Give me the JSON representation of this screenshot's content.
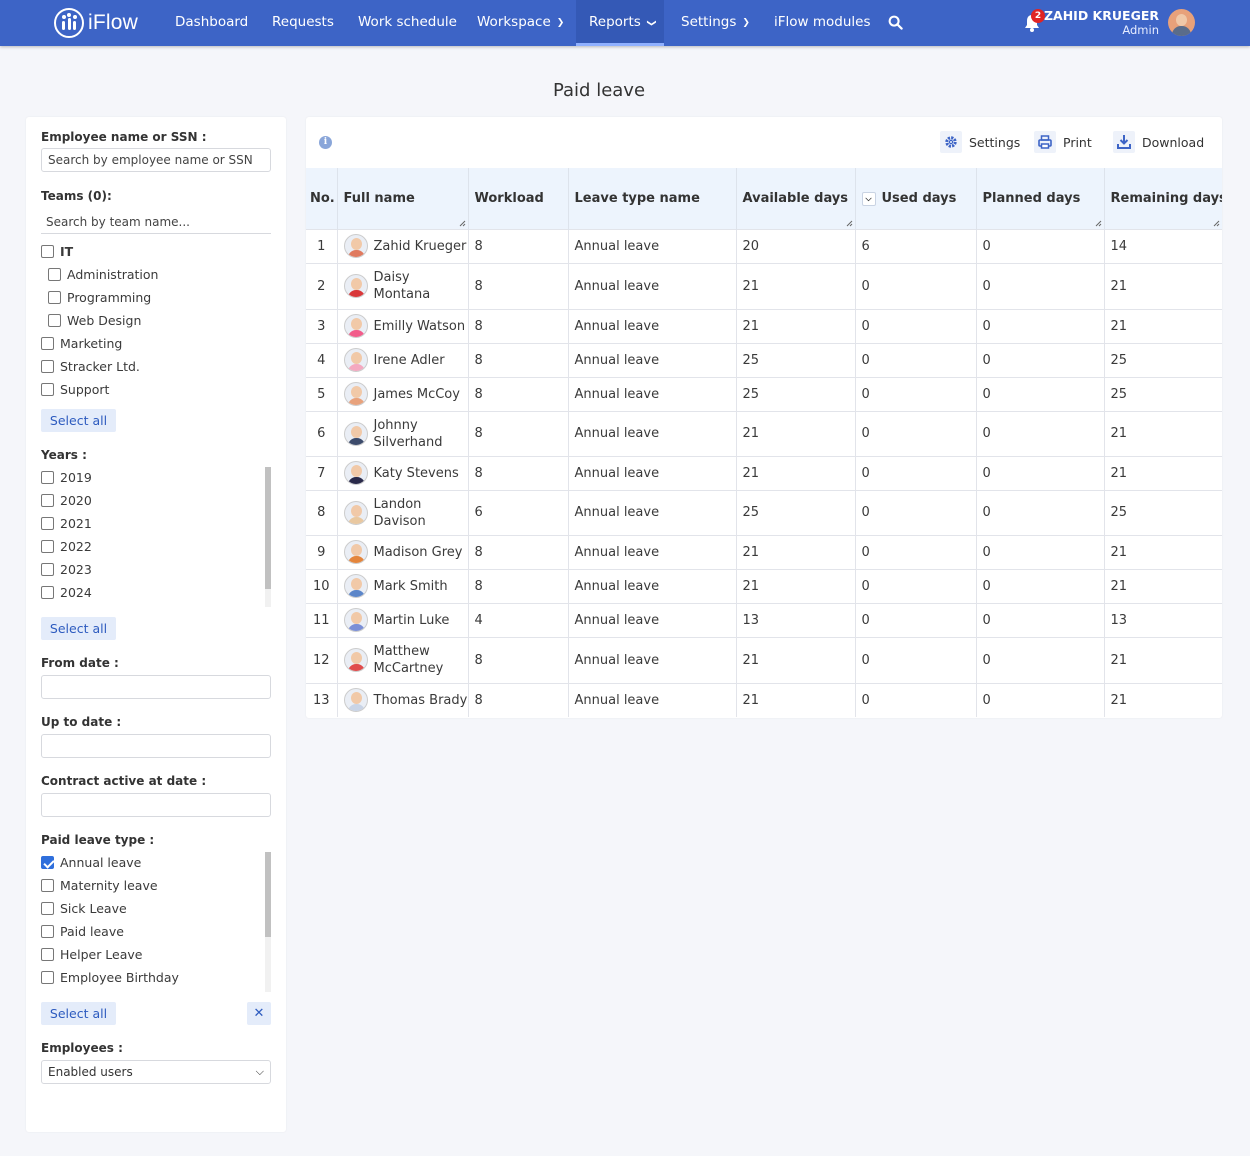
{
  "app": {
    "brand": "iFlow"
  },
  "nav": {
    "items": [
      {
        "label": "Dashboard"
      },
      {
        "label": "Requests"
      },
      {
        "label": "Work schedule"
      },
      {
        "label": "Workspace"
      },
      {
        "label": "Reports"
      },
      {
        "label": "Settings"
      },
      {
        "label": "iFlow modules"
      }
    ],
    "notifications": "2",
    "user": {
      "name": "ZAHID KRUEGER",
      "role": "Admin"
    }
  },
  "page": {
    "title": "Paid leave"
  },
  "filters": {
    "employee_label": "Employee name or SSN :",
    "employee_placeholder": "Search by employee name or SSN",
    "teams_label": "Teams (0):",
    "teams_placeholder": "Search by team name...",
    "teams": [
      {
        "label": "IT",
        "checked": false
      },
      {
        "label": "Administration",
        "checked": false
      },
      {
        "label": "Programming",
        "checked": false
      },
      {
        "label": "Web Design",
        "checked": false
      },
      {
        "label": "Marketing",
        "checked": false
      },
      {
        "label": "Stracker Ltd.",
        "checked": false
      },
      {
        "label": "Support",
        "checked": false
      }
    ],
    "select_all": "Select all",
    "years_label": "Years :",
    "years": [
      "2019",
      "2020",
      "2021",
      "2022",
      "2023",
      "2024"
    ],
    "from_date_label": "From date :",
    "up_to_date_label": "Up to date :",
    "contract_label": "Contract active at date :",
    "leave_type_label": "Paid leave type :",
    "leave_types": [
      {
        "label": "Annual leave",
        "checked": true
      },
      {
        "label": "Maternity leave",
        "checked": false
      },
      {
        "label": "Sick Leave",
        "checked": false
      },
      {
        "label": "Paid leave",
        "checked": false
      },
      {
        "label": "Helper Leave",
        "checked": false
      },
      {
        "label": "Employee Birthday",
        "checked": false
      }
    ],
    "clear_symbol": "✕",
    "employees_label": "Employees :",
    "employees_value": "Enabled users"
  },
  "toolbar": {
    "settings": "Settings",
    "print": "Print",
    "download": "Download"
  },
  "table": {
    "columns": [
      "No.",
      "Full name",
      "Workload",
      "Leave type name",
      "Available days",
      "Used days",
      "Planned days",
      "Remaining days"
    ],
    "rows": [
      {
        "no": "1",
        "name": "Zahid Krueger",
        "workload": "8",
        "type": "Annual leave",
        "available": "20",
        "used": "6",
        "planned": "0",
        "remaining": "14",
        "av": "#e07a5f"
      },
      {
        "no": "2",
        "name": "Daisy Montana",
        "workload": "8",
        "type": "Annual leave",
        "available": "21",
        "used": "0",
        "planned": "0",
        "remaining": "21",
        "av": "#d9383a"
      },
      {
        "no": "3",
        "name": "Emilly Watson",
        "workload": "8",
        "type": "Annual leave",
        "available": "21",
        "used": "0",
        "planned": "0",
        "remaining": "21",
        "av": "#f25c8a"
      },
      {
        "no": "4",
        "name": "Irene Adler",
        "workload": "8",
        "type": "Annual leave",
        "available": "25",
        "used": "0",
        "planned": "0",
        "remaining": "25",
        "av": "#f4a9c0"
      },
      {
        "no": "5",
        "name": "James McCoy",
        "workload": "8",
        "type": "Annual leave",
        "available": "25",
        "used": "0",
        "planned": "0",
        "remaining": "25",
        "av": "#e8a27c"
      },
      {
        "no": "6",
        "name": "Johnny Silverhand",
        "workload": "8",
        "type": "Annual leave",
        "available": "21",
        "used": "0",
        "planned": "0",
        "remaining": "21",
        "av": "#3c4b6b"
      },
      {
        "no": "7",
        "name": "Katy Stevens",
        "workload": "8",
        "type": "Annual leave",
        "available": "21",
        "used": "0",
        "planned": "0",
        "remaining": "21",
        "av": "#2a2a4a"
      },
      {
        "no": "8",
        "name": "Landon Davison",
        "workload": "6",
        "type": "Annual leave",
        "available": "25",
        "used": "0",
        "planned": "0",
        "remaining": "25",
        "av": "#e9c8a0"
      },
      {
        "no": "9",
        "name": "Madison Grey",
        "workload": "8",
        "type": "Annual leave",
        "available": "21",
        "used": "0",
        "planned": "0",
        "remaining": "21",
        "av": "#e4853c"
      },
      {
        "no": "10",
        "name": "Mark Smith",
        "workload": "8",
        "type": "Annual leave",
        "available": "21",
        "used": "0",
        "planned": "0",
        "remaining": "21",
        "av": "#5c86c9"
      },
      {
        "no": "11",
        "name": "Martin Luke",
        "workload": "4",
        "type": "Annual leave",
        "available": "13",
        "used": "0",
        "planned": "0",
        "remaining": "13",
        "av": "#7b8fd6"
      },
      {
        "no": "12",
        "name": "Matthew McCartney",
        "workload": "8",
        "type": "Annual leave",
        "available": "21",
        "used": "0",
        "planned": "0",
        "remaining": "21",
        "av": "#e04b4b"
      },
      {
        "no": "13",
        "name": "Thomas Brady",
        "workload": "8",
        "type": "Annual leave",
        "available": "21",
        "used": "0",
        "planned": "0",
        "remaining": "21",
        "av": "#c9d4e6"
      }
    ]
  },
  "colors": {
    "navbar": "#3d64c6",
    "accent": "#2d5bbf",
    "header_bg": "#edf4fd"
  }
}
